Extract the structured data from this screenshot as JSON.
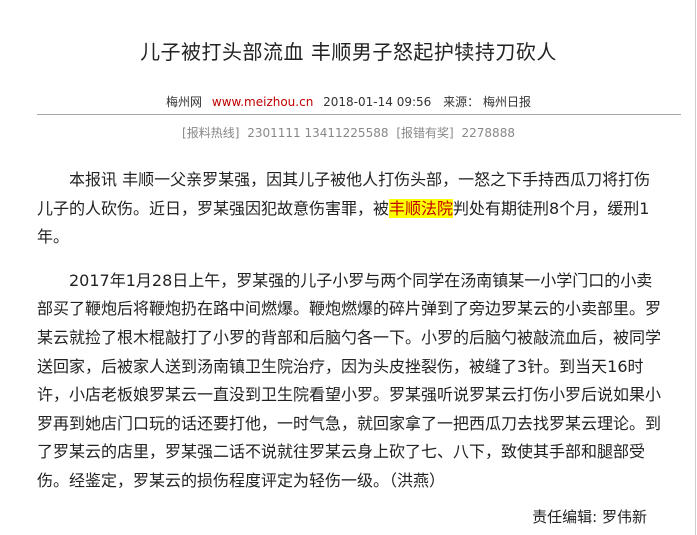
{
  "article": {
    "title": "儿子被打头部流血 丰顺男子怒起护犊持刀砍人",
    "meta": {
      "source_name": "梅州网",
      "source_url": "www.meizhou.cn",
      "datetime": "2018-01-14 09:56",
      "source_label": "来源：",
      "source": "梅州日报"
    },
    "hotline": {
      "label1": "[报料热线]",
      "numbers1": "2301111 13411225588",
      "label2": "[报错有奖]",
      "number2": "2278888"
    },
    "paragraph1": {
      "before": "本报讯 丰顺一父亲罗某强，因其儿子被他人打伤头部，一怒之下手持西瓜刀将打伤儿子的人砍伤。近日，罗某强因犯故意伤害罪，被",
      "highlight": "丰顺法院",
      "after": "判处有期徒刑8个月，缓刑1年。"
    },
    "paragraph2": "2017年1月28日上午，罗某强的儿子小罗与两个同学在汤南镇某一小学门口的小卖部买了鞭炮后将鞭炮扔在路中间燃爆。鞭炮燃爆的碎片弹到了旁边罗某云的小卖部里。罗某云就捡了根木棍敲打了小罗的背部和后脑勺各一下。小罗的后脑勺被敲流血后，被同学送回家，后被家人送到汤南镇卫生院治疗，因为头皮挫裂伤，被缝了3针。到当天16时许，小店老板娘罗某云一直没到卫生院看望小罗。罗某强听说罗某云打伤小罗后说如果小罗再到她店门口玩的话还要打他，一时气急，就回家拿了一把西瓜刀去找罗某云理论。到了罗某云的店里，罗某强二话不说就往罗某云身上砍了七、八下，致使其手部和腿部受伤。经鉴定，罗某云的损伤程度评定为轻伤一级。（洪燕）",
    "editor": "责任编辑: 罗伟新"
  }
}
